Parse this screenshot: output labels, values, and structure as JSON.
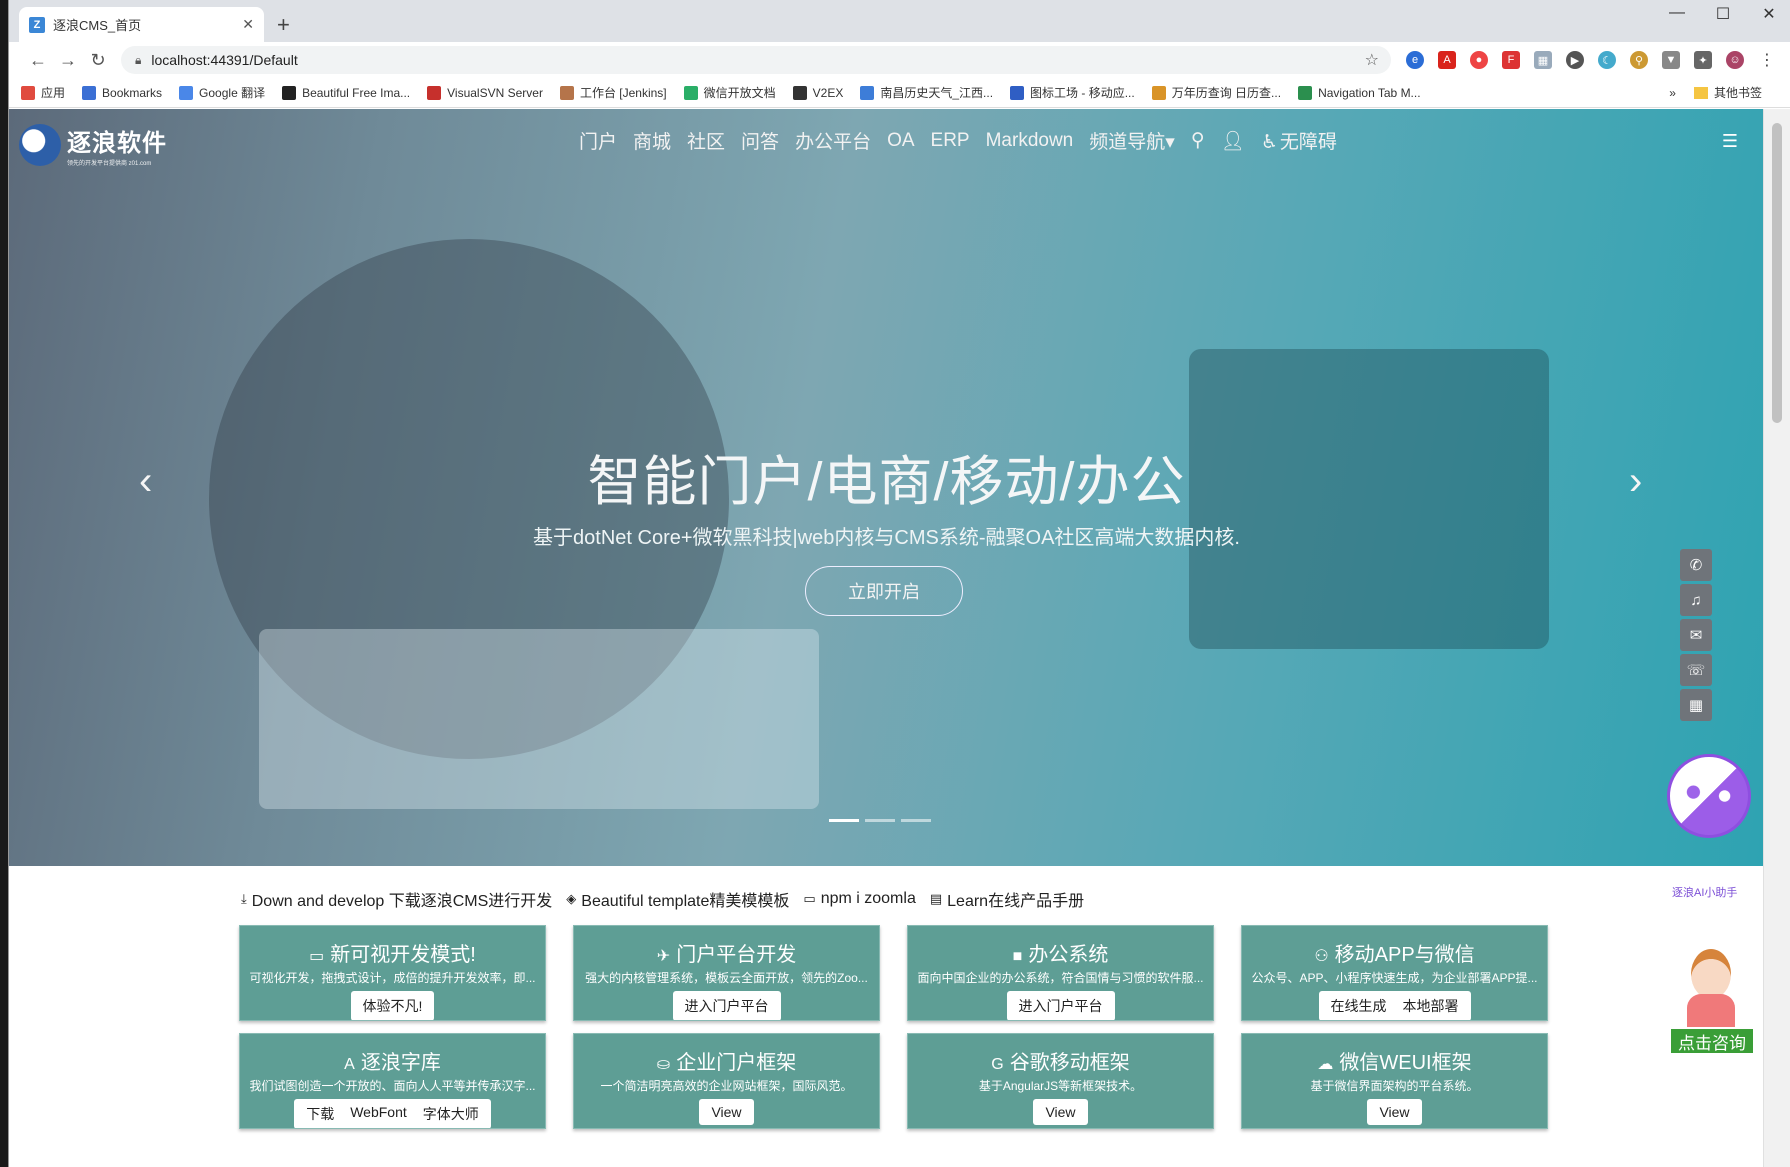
{
  "browser": {
    "tab_title": "逐浪CMS_首页",
    "tab_favicon_letter": "Z",
    "new_tab": "+",
    "url": "localhost:44391/Default",
    "controls": {
      "minimize": "—",
      "maximize": "☐",
      "close": "✕"
    },
    "bookmarks": [
      {
        "label": "应用",
        "color": "#e04b3f"
      },
      {
        "label": "Bookmarks",
        "color": "#3b6fd4"
      },
      {
        "label": "Google 翻译",
        "color": "#4a87e8"
      },
      {
        "label": "Beautiful Free Ima...",
        "color": "#222222"
      },
      {
        "label": "VisualSVN Server",
        "color": "#c6302c"
      },
      {
        "label": "工作台 [Jenkins]",
        "color": "#b5744a"
      },
      {
        "label": "微信开放文档",
        "color": "#2aae67"
      },
      {
        "label": "V2EX",
        "color": "#333333"
      },
      {
        "label": "南昌历史天气_江西...",
        "color": "#3d7dd8"
      },
      {
        "label": "图标工场 - 移动应...",
        "color": "#2f5ec4"
      },
      {
        "label": "万年历查询 日历查...",
        "color": "#d99428"
      },
      {
        "label": "Navigation Tab M...",
        "color": "#2b8f4e"
      }
    ],
    "bookmarks_overflow": "»",
    "other_bookmarks": "其他书签"
  },
  "site": {
    "logo_name": "逐浪软件",
    "logo_sub": "领先的开发平台提供商 z01.com",
    "nav": [
      "门户",
      "商城",
      "社区",
      "问答",
      "办公平台",
      "OA",
      "ERP",
      "Markdown",
      "频道导航▾"
    ],
    "accessibility": "无障碍",
    "hero_title": "智能门户/电商/移动/办公",
    "hero_subtitle": "基于dotNet Core+微软黑科技|web内核与CMS系统-融聚OA社区高端大数据内核.",
    "hero_button": "立即开启",
    "ai_label": "逐浪AI小助手",
    "consult_label": "点击咨询",
    "quicklinks": [
      {
        "icon": "⤓",
        "label": "Down and develop 下载逐浪CMS进行开发"
      },
      {
        "icon": "◈",
        "label": "Beautiful template精美模模板"
      },
      {
        "icon": "▭",
        "label": "npm i zoomla"
      },
      {
        "icon": "▤",
        "label": "Learn在线产品手册"
      }
    ],
    "cards": [
      {
        "icon": "▭",
        "title": "新可视开发模式!",
        "desc": "可视化开发，拖拽式设计，成倍的提升开发效率，即...",
        "buttons": [
          "体验不凡!"
        ]
      },
      {
        "icon": "✈",
        "title": "门户平台开发",
        "desc": "强大的内核管理系统，模板云全面开放，领先的Zoo...",
        "buttons": [
          "进入门户平台"
        ]
      },
      {
        "icon": "■",
        "title": "办公系统",
        "desc": "面向中国企业的办公系统，符合国情与习惯的软件服...",
        "buttons": [
          "进入门户平台"
        ]
      },
      {
        "icon": "⚇",
        "title": "移动APP与微信",
        "desc": "公众号、APP、小程序快速生成，为企业部署APP提...",
        "buttons": [
          "在线生成",
          "本地部署"
        ]
      },
      {
        "icon": "A",
        "title": "逐浪字库",
        "desc": "我们试图创造一个开放的、面向人人平等并传承汉字...",
        "buttons": [
          "下载",
          "WebFont",
          "字体大师"
        ]
      },
      {
        "icon": "⛀",
        "title": "企业门户框架",
        "desc": "一个简洁明亮高效的企业网站框架，国际风范。",
        "buttons": [
          "View"
        ]
      },
      {
        "icon": "G",
        "title": "谷歌移动框架",
        "desc": "基于AngularJS等新框架技术。",
        "buttons": [
          "View"
        ]
      },
      {
        "icon": "☁",
        "title": "微信WEUI框架",
        "desc": "基于微信界面架构的平台系统。",
        "buttons": [
          "View"
        ]
      }
    ]
  }
}
